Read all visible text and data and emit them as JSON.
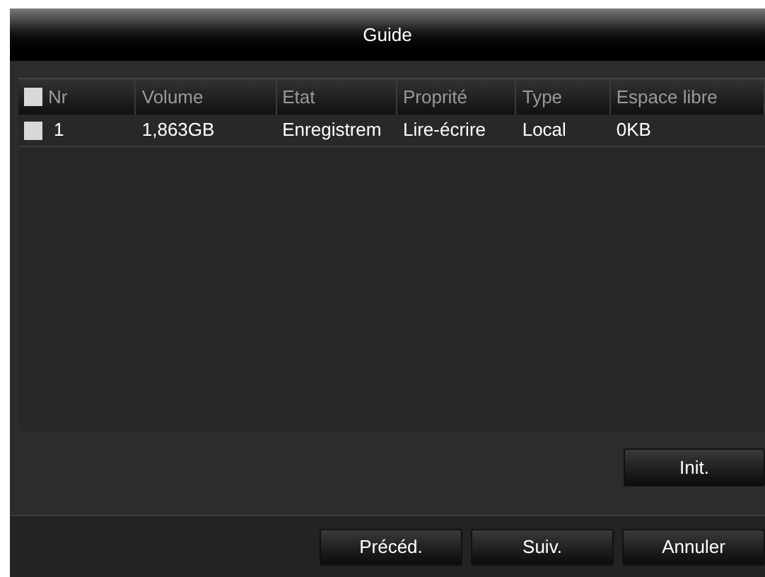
{
  "window": {
    "title": "Guide"
  },
  "table": {
    "select_all": {
      "checked": false
    },
    "columns": [
      "Nr",
      "Volume",
      "Etat",
      "Proprité",
      "Type",
      "Espace libre"
    ],
    "rows": [
      {
        "checked": false,
        "cells": [
          "1",
          "1,863GB",
          "Enregistrem",
          "Lire-écrire",
          "Local",
          "0KB"
        ]
      }
    ]
  },
  "init_button": "Init.",
  "buttons": [
    "Précéd.",
    "Suiv.",
    "Annuler"
  ]
}
